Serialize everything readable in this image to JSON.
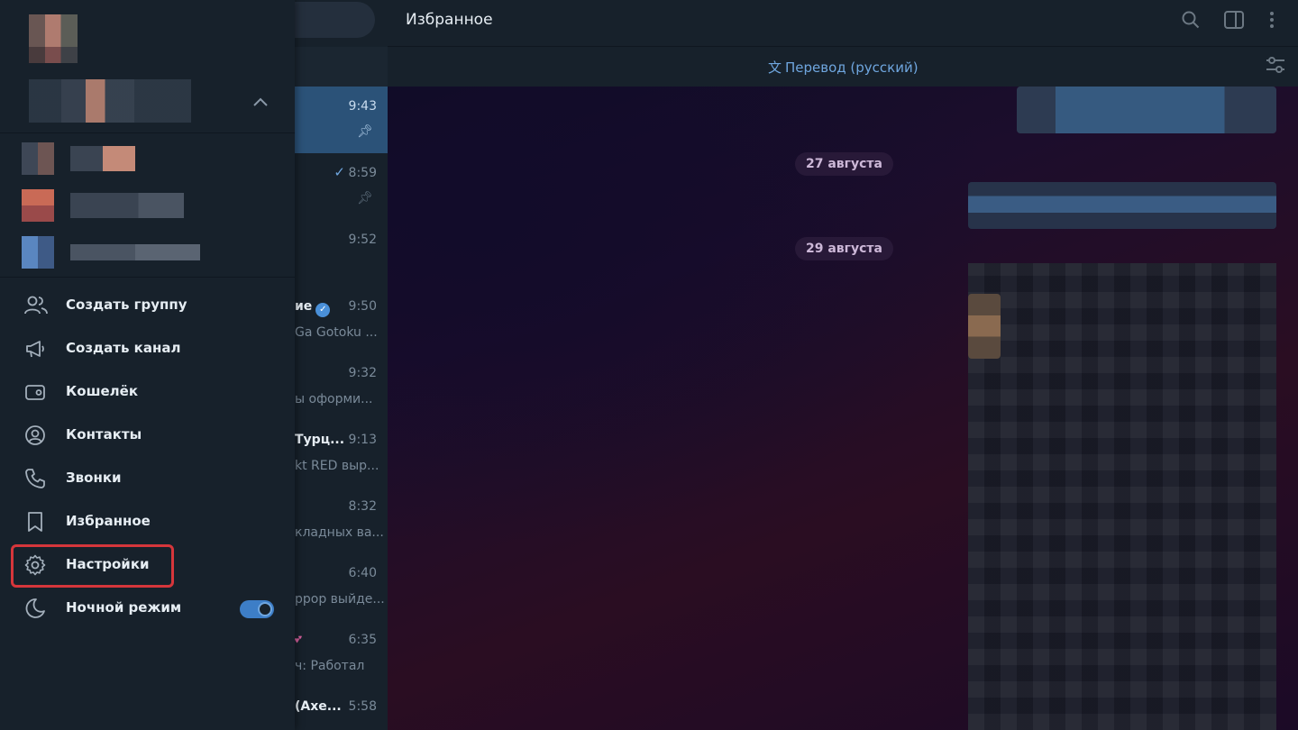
{
  "chat_title": "Избранное",
  "translate_bar": {
    "label": "Перевод (русский)"
  },
  "date_separators": [
    "27 августа",
    "29 августа"
  ],
  "chat_rows": [
    {
      "time": "9:43",
      "name": "",
      "preview": "",
      "active": true
    },
    {
      "time": "8:59",
      "name": "",
      "preview": ""
    },
    {
      "time": "9:52",
      "name": "",
      "preview": ""
    },
    {
      "time": "9:50",
      "name": "ие",
      "preview": "Ga Gotoku ..."
    },
    {
      "time": "9:32",
      "name": "",
      "preview": "ы оформи..."
    },
    {
      "time": "9:13",
      "name": "Турц...",
      "preview": "kt RED выр..."
    },
    {
      "time": "8:32",
      "name": "",
      "preview": "кладных ва..."
    },
    {
      "time": "6:40",
      "name": "",
      "preview": "ррор выйде..."
    },
    {
      "time": "6:35",
      "name": "",
      "preview": "ч: Работал"
    },
    {
      "time": "5:58",
      "name": "(Axe...",
      "preview": ""
    }
  ],
  "menu": {
    "create_group": "Создать группу",
    "create_channel": "Создать канал",
    "wallet": "Кошелёк",
    "contacts": "Контакты",
    "calls": "Звонки",
    "saved": "Избранное",
    "settings": "Настройки",
    "night_mode": "Ночной режим"
  },
  "night_mode_enabled": true,
  "colors": {
    "accent": "#6fa6df",
    "highlight_border": "#d6363b",
    "panel": "#17212b",
    "active_row": "#2b5278"
  }
}
